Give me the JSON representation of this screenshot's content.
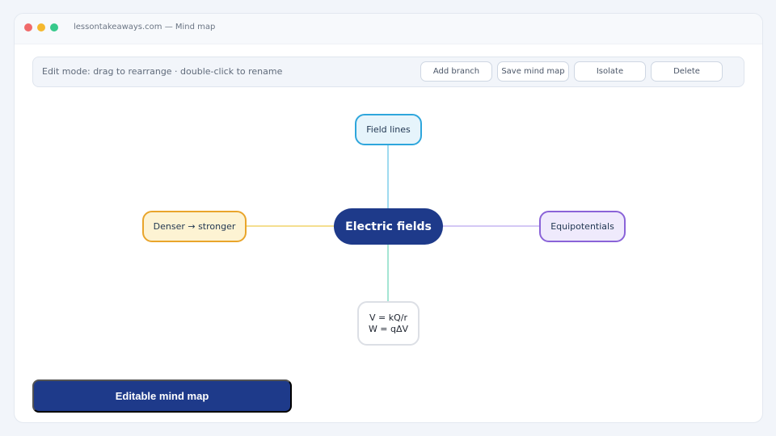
{
  "window": {
    "title": "lessontakeaways.com — Mind map"
  },
  "toolbar": {
    "hint": "Edit mode: drag to rearrange · double-click to rename",
    "buttons": {
      "add_branch": "Add branch",
      "save": "Save mind map",
      "isolate": "Isolate",
      "delete": "Delete"
    }
  },
  "mindmap": {
    "center": "Electric fields",
    "top": "Field lines",
    "left": "Denser → stronger",
    "right": "Equipotentials",
    "bottom": {
      "line1": "V = kQ/r",
      "line2": "W = qΔV"
    }
  },
  "colors": {
    "accent": "#1e3a8a",
    "top_branch": "#2ea6dc",
    "left_branch": "#e9a52b",
    "right_branch": "#8a63d8",
    "bottom_branch": "#37c9a8"
  },
  "cta": {
    "label": "Editable mind map"
  }
}
